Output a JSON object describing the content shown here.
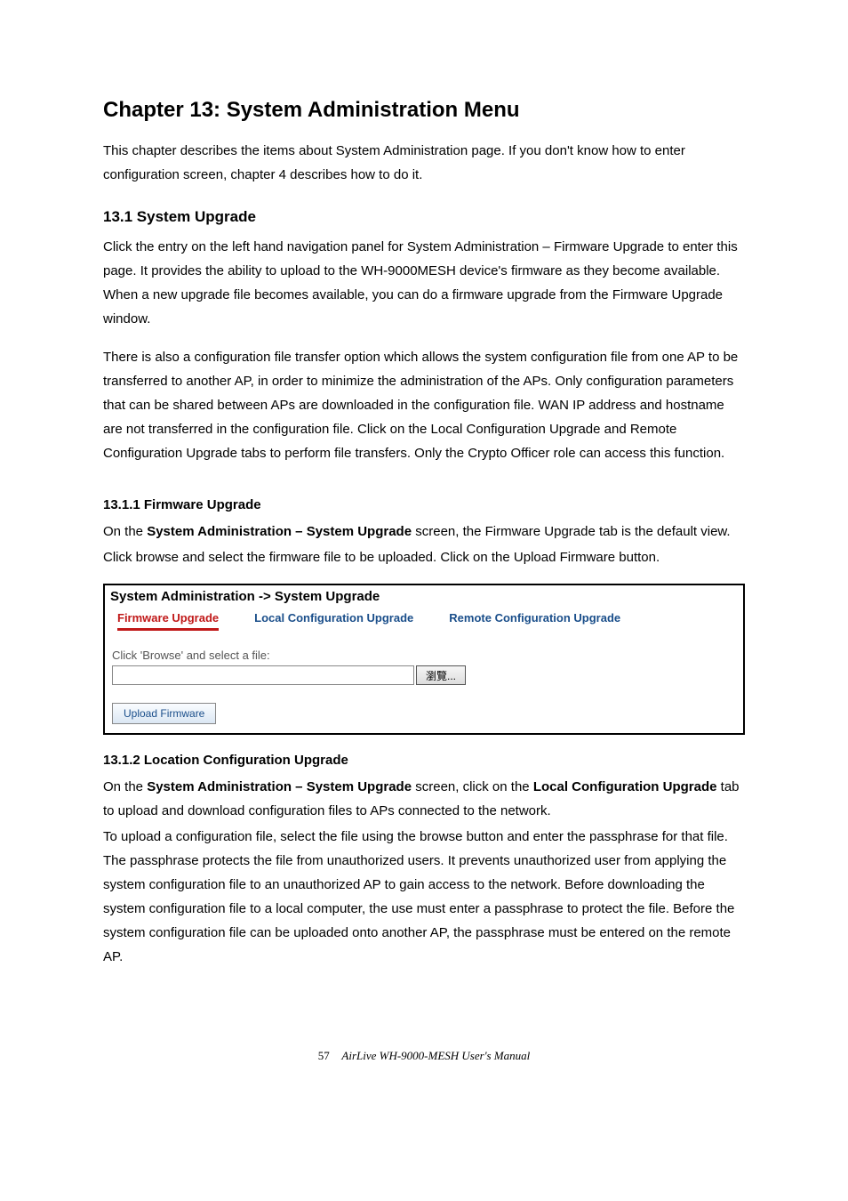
{
  "chapter_title": "Chapter 13: System Administration Menu",
  "intro": "This chapter describes the items about System Administration page. If you don't know how to enter configuration screen, chapter 4 describes how to do it.",
  "s131": {
    "heading": "13.1 System Upgrade",
    "p1": "Click the entry on the left hand navigation panel for System Administration – Firmware Upgrade to enter this page. It provides the ability to upload to the WH-9000MESH device's firmware as they become available. When a new upgrade file becomes available, you can do a firmware upgrade from the Firmware Upgrade window.",
    "p2": "There is also a configuration file transfer option which allows the system configuration file from one AP to be transferred to another AP, in order to minimize the administration of the APs. Only configuration parameters that can be shared between APs are downloaded in the configuration file. WAN IP address and hostname are not transferred in the configuration file. Click on the Local Configuration Upgrade and Remote Configuration Upgrade tabs to perform file transfers. Only the Crypto Officer role can access this function."
  },
  "s1311": {
    "heading": "13.1.1 Firmware Upgrade",
    "p1_pre": "On the ",
    "p1_bold": "System Administration – System Upgrade",
    "p1_post": " screen, the Firmware Upgrade tab is the default view.",
    "p2": "Click browse and select the firmware file to be uploaded. Click on the Upload Firmware button."
  },
  "ui": {
    "title": "System Administration -> System Upgrade",
    "tabs": {
      "firmware": "Firmware Upgrade",
      "local": "Local Configuration Upgrade",
      "remote": "Remote Configuration Upgrade"
    },
    "browse_label": "Click 'Browse' and select a file:",
    "browse_btn": "瀏覽...",
    "upload_btn": "Upload Firmware"
  },
  "s1312": {
    "heading": "13.1.2 Location Configuration Upgrade",
    "p1_a": "On the ",
    "p1_b": "System Administration – System Upgrade",
    "p1_c": " screen, click on the ",
    "p1_d": "Local Configuration Upgrade",
    "p1_e": " tab to upload and download configuration files to APs connected to the network.",
    "p2": "To upload a configuration file, select the file using the browse button and enter the passphrase for that file. The passphrase protects the file from unauthorized users. It prevents unauthorized user from applying the system configuration file to an unauthorized AP to gain access to the network. Before downloading the system configuration file to a local computer, the use must enter a passphrase to protect the file. Before the system configuration file can be uploaded onto another AP, the passphrase must be entered on the remote AP."
  },
  "footer": {
    "page": "57",
    "doc": "AirLive WH-9000-MESH User's Manual"
  }
}
